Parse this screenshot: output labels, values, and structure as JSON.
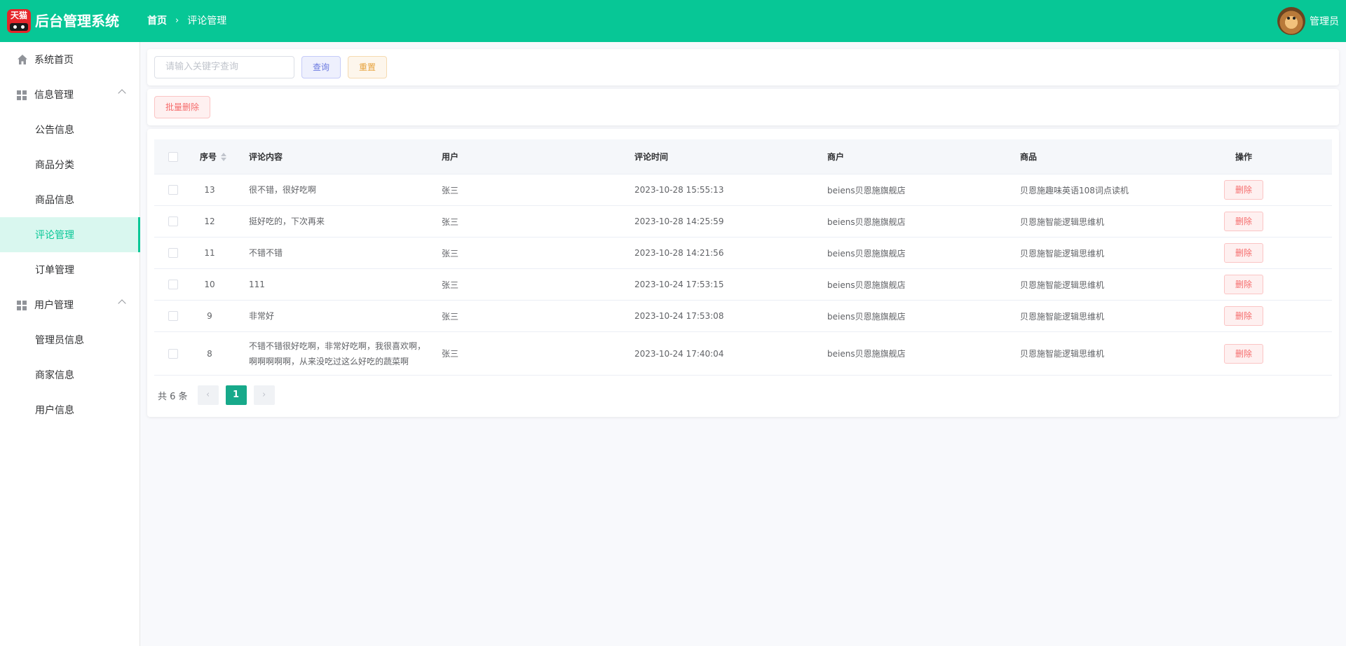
{
  "header": {
    "logo_text": "天猫",
    "app_title": "后台管理系统",
    "breadcrumb": {
      "home": "首页",
      "separator": "›",
      "current": "评论管理"
    },
    "user_name": "管理员",
    "brand_color": "#07c796"
  },
  "sidebar": {
    "items": [
      {
        "label": "系统首页",
        "icon": "home-icon"
      },
      {
        "label": "信息管理",
        "icon": "grid-icon",
        "expanded": true
      },
      {
        "label": "公告信息"
      },
      {
        "label": "商品分类"
      },
      {
        "label": "商品信息"
      },
      {
        "label": "评论管理",
        "active": true
      },
      {
        "label": "订单管理"
      },
      {
        "label": "用户管理",
        "icon": "grid-icon",
        "expanded": true
      },
      {
        "label": "管理员信息"
      },
      {
        "label": "商家信息"
      },
      {
        "label": "用户信息"
      }
    ]
  },
  "search": {
    "placeholder": "请输入关键字查询",
    "value": "",
    "query_label": "查询",
    "reset_label": "重置"
  },
  "toolbar": {
    "batch_delete_label": "批量删除"
  },
  "table": {
    "columns": [
      "序号",
      "评论内容",
      "用户",
      "评论时间",
      "商户",
      "商品",
      "操作"
    ],
    "rows": [
      {
        "id": "13",
        "content": "很不错，很好吃啊",
        "user": "张三",
        "time": "2023-10-28 15:55:13",
        "merchant": "beiens贝恩施旗舰店",
        "product": "贝恩施趣味英语108词点读机",
        "action": "删除"
      },
      {
        "id": "12",
        "content": "挺好吃的，下次再来",
        "user": "张三",
        "time": "2023-10-28 14:25:59",
        "merchant": "beiens贝恩施旗舰店",
        "product": "贝恩施智能逻辑思维机",
        "action": "删除"
      },
      {
        "id": "11",
        "content": "不错不错",
        "user": "张三",
        "time": "2023-10-28 14:21:56",
        "merchant": "beiens贝恩施旗舰店",
        "product": "贝恩施智能逻辑思维机",
        "action": "删除"
      },
      {
        "id": "10",
        "content": "111",
        "user": "张三",
        "time": "2023-10-24 17:53:15",
        "merchant": "beiens贝恩施旗舰店",
        "product": "贝恩施智能逻辑思维机",
        "action": "删除"
      },
      {
        "id": "9",
        "content": "非常好",
        "user": "张三",
        "time": "2023-10-24 17:53:08",
        "merchant": "beiens贝恩施旗舰店",
        "product": "贝恩施智能逻辑思维机",
        "action": "删除"
      },
      {
        "id": "8",
        "content": "不错不错很好吃啊，非常好吃啊，我很喜欢啊，啊啊啊啊啊，从来没吃过这么好吃的蔬菜啊",
        "user": "张三",
        "time": "2023-10-24 17:40:04",
        "merchant": "beiens贝恩施旗舰店",
        "product": "贝恩施智能逻辑思维机",
        "action": "删除"
      }
    ]
  },
  "pagination": {
    "total_text": "共 6 条",
    "prev": "‹",
    "current_page": "1",
    "next": "›"
  }
}
